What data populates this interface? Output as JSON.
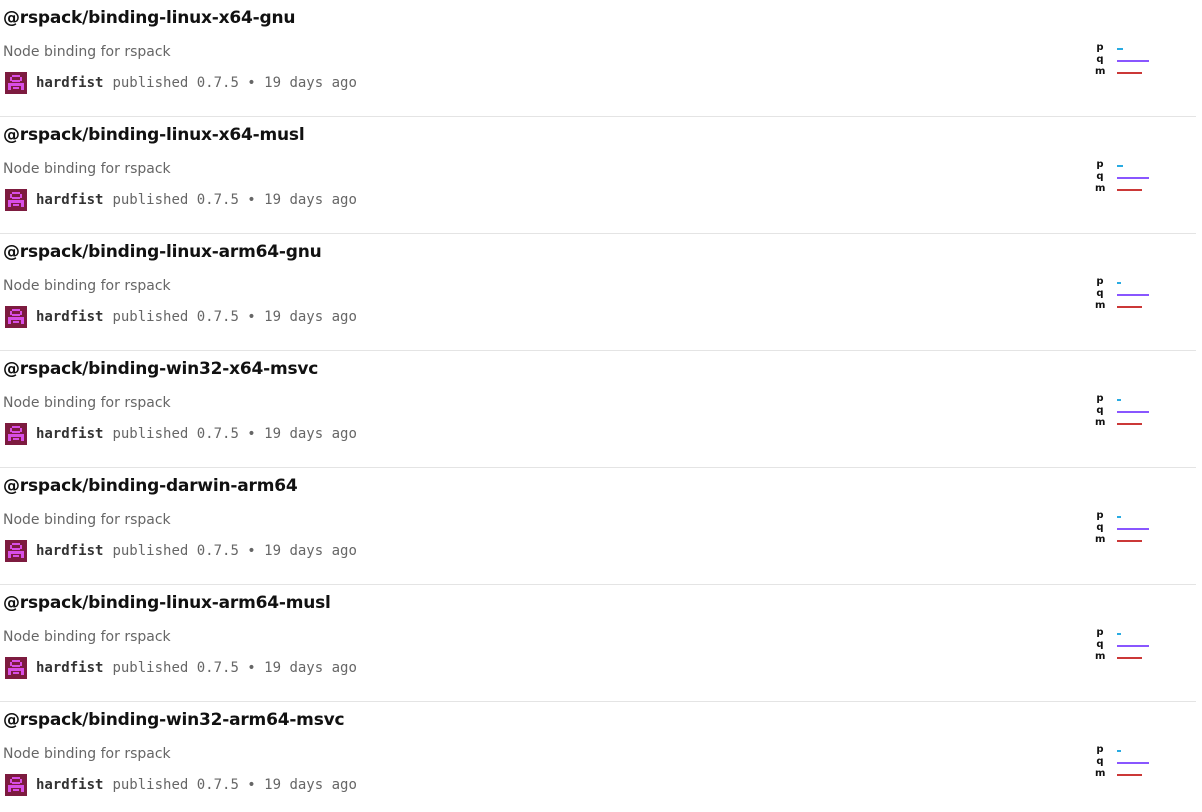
{
  "colors": {
    "popularity": "#29abe2",
    "quality": "#8956ff",
    "maintenance": "#cb3837",
    "avatar_bg": "#7d1b3f",
    "avatar_fg": "#d84ee6"
  },
  "packages": [
    {
      "name": "@rspack/binding-linux-x64-gnu",
      "description": "Node binding for rspack",
      "publisher": "hardfist",
      "avatar_icon": "identicon-avatar",
      "published_text": "published 0.7.5 • 19 days ago",
      "score": {
        "labels": [
          "p",
          "q",
          "m"
        ],
        "popularity": 0.18,
        "quality": 1.0,
        "maintenance": 0.78
      }
    },
    {
      "name": "@rspack/binding-linux-x64-musl",
      "description": "Node binding for rspack",
      "publisher": "hardfist",
      "avatar_icon": "identicon-avatar",
      "published_text": "published 0.7.5 • 19 days ago",
      "score": {
        "labels": [
          "p",
          "q",
          "m"
        ],
        "popularity": 0.18,
        "quality": 1.0,
        "maintenance": 0.78
      }
    },
    {
      "name": "@rspack/binding-linux-arm64-gnu",
      "description": "Node binding for rspack",
      "publisher": "hardfist",
      "avatar_icon": "identicon-avatar",
      "published_text": "published 0.7.5 • 19 days ago",
      "score": {
        "labels": [
          "p",
          "q",
          "m"
        ],
        "popularity": 0.12,
        "quality": 1.0,
        "maintenance": 0.78
      }
    },
    {
      "name": "@rspack/binding-win32-x64-msvc",
      "description": "Node binding for rspack",
      "publisher": "hardfist",
      "avatar_icon": "identicon-avatar",
      "published_text": "published 0.7.5 • 19 days ago",
      "score": {
        "labels": [
          "p",
          "q",
          "m"
        ],
        "popularity": 0.12,
        "quality": 1.0,
        "maintenance": 0.78
      }
    },
    {
      "name": "@rspack/binding-darwin-arm64",
      "description": "Node binding for rspack",
      "publisher": "hardfist",
      "avatar_icon": "identicon-avatar",
      "published_text": "published 0.7.5 • 19 days ago",
      "score": {
        "labels": [
          "p",
          "q",
          "m"
        ],
        "popularity": 0.12,
        "quality": 1.0,
        "maintenance": 0.78
      }
    },
    {
      "name": "@rspack/binding-linux-arm64-musl",
      "description": "Node binding for rspack",
      "publisher": "hardfist",
      "avatar_icon": "identicon-avatar",
      "published_text": "published 0.7.5 • 19 days ago",
      "score": {
        "labels": [
          "p",
          "q",
          "m"
        ],
        "popularity": 0.12,
        "quality": 1.0,
        "maintenance": 0.78
      }
    },
    {
      "name": "@rspack/binding-win32-arm64-msvc",
      "description": "Node binding for rspack",
      "publisher": "hardfist",
      "avatar_icon": "identicon-avatar",
      "published_text": "published 0.7.5 • 19 days ago",
      "score": {
        "labels": [
          "p",
          "q",
          "m"
        ],
        "popularity": 0.12,
        "quality": 1.0,
        "maintenance": 0.78
      }
    }
  ]
}
